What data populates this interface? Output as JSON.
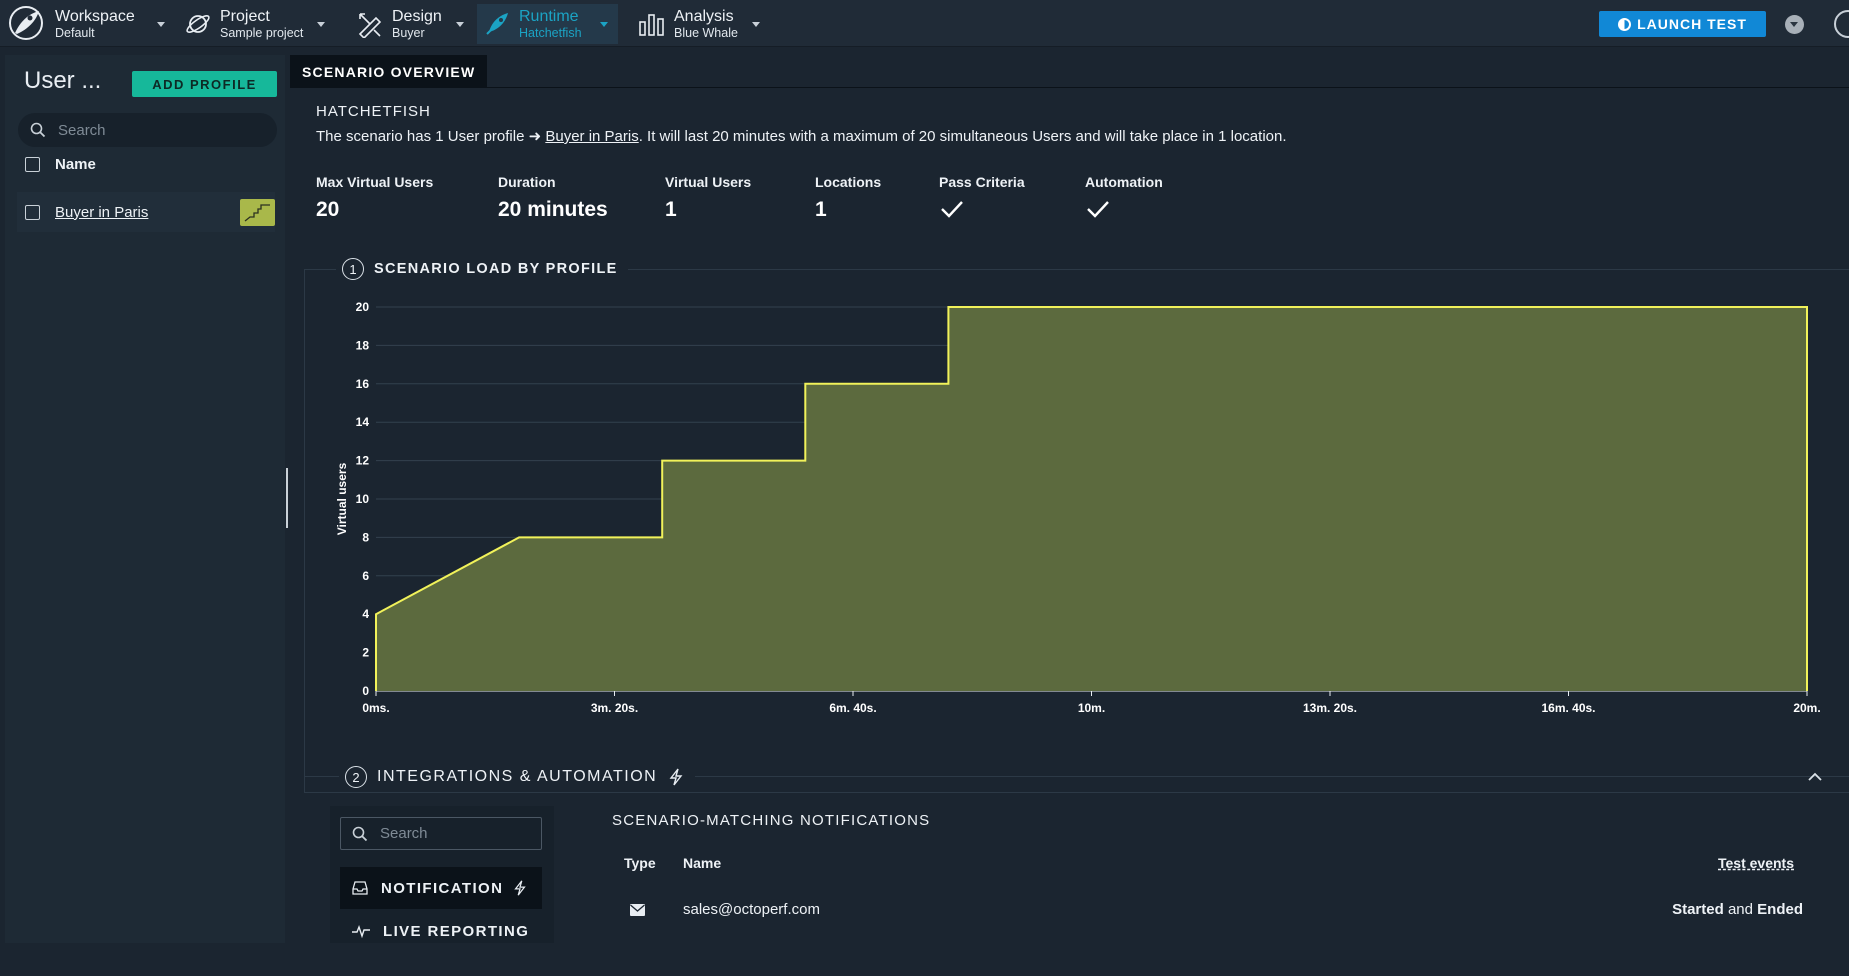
{
  "nav": {
    "items": [
      {
        "label": "Workspace",
        "sub": "Default",
        "icon": "planet-icon"
      },
      {
        "label": "Project",
        "sub": "Sample project",
        "icon": "planet-ring-icon"
      },
      {
        "label": "Design",
        "sub": "Buyer",
        "icon": "design-tools-icon"
      },
      {
        "label": "Runtime",
        "sub": "Hatchetfish",
        "icon": "rocket-icon"
      },
      {
        "label": "Analysis",
        "sub": "Blue Whale",
        "icon": "bar-chart-icon"
      }
    ],
    "launch_label": "LAUNCH TEST",
    "accent": "#1ba3c4",
    "launch_color": "#1188d6"
  },
  "sidebar": {
    "title": "User ...",
    "add_profile_label": "ADD PROFILE",
    "search_placeholder": "Search",
    "column_name": "Name",
    "profiles": [
      {
        "name": "Buyer in Paris",
        "color": "#a9b84a"
      }
    ],
    "add_color": "#16b89a"
  },
  "tab": {
    "label": "SCENARIO OVERVIEW"
  },
  "scenario": {
    "name": "HATCHETFISH",
    "desc_prefix": "The scenario has 1 User profile ➜ ",
    "desc_link": "Buyer in Paris",
    "desc_suffix": ". It will last 20 minutes with a maximum of 20 simultaneous Users and will take place in 1 location."
  },
  "stats": {
    "max_vu_label": "Max Virtual Users",
    "max_vu_value": "20",
    "duration_label": "Duration",
    "duration_value": "20 minutes",
    "vu_label": "Virtual Users",
    "vu_value": "1",
    "locations_label": "Locations",
    "locations_value": "1",
    "pass_label": "Pass Criteria",
    "automation_label": "Automation"
  },
  "load_section": {
    "number": "1",
    "title": "SCENARIO LOAD BY PROFILE"
  },
  "chart_data": {
    "type": "area",
    "title": "",
    "xlabel": "",
    "ylabel": "Virtual users",
    "x_unit": "seconds",
    "xlim": [
      0,
      1200
    ],
    "ylim": [
      0,
      20
    ],
    "x_ticks": [
      {
        "v": 0,
        "label": "0ms."
      },
      {
        "v": 200,
        "label": "3m. 20s."
      },
      {
        "v": 400,
        "label": "6m. 40s."
      },
      {
        "v": 600,
        "label": "10m."
      },
      {
        "v": 800,
        "label": "13m. 20s."
      },
      {
        "v": 1000,
        "label": "16m. 40s."
      },
      {
        "v": 1200,
        "label": "20m."
      }
    ],
    "y_ticks": [
      0,
      2,
      4,
      6,
      8,
      10,
      12,
      14,
      16,
      18,
      20
    ],
    "series": [
      {
        "name": "Buyer in Paris",
        "color": "#f1f25a",
        "fill": "#5c6a3e",
        "x": [
          0,
          0,
          120,
          240,
          240,
          360,
          360,
          480,
          480,
          1200,
          1200
        ],
        "y": [
          0,
          4,
          8,
          8,
          12,
          12,
          16,
          16,
          20,
          20,
          0
        ]
      }
    ],
    "grid": true
  },
  "integrations": {
    "number": "2",
    "title": "INTEGRATIONS & AUTOMATION",
    "search_placeholder": "Search",
    "items": [
      {
        "label": "NOTIFICATION",
        "icon": "inbox-icon"
      },
      {
        "label": "LIVE REPORTING",
        "icon": "pulse-icon"
      }
    ],
    "notifications_title": "SCENARIO-MATCHING NOTIFICATIONS",
    "columns": {
      "type": "Type",
      "name": "Name",
      "events": "Test events"
    },
    "rows": [
      {
        "type_icon": "mail-icon",
        "name": "sales@octoperf.com",
        "ev1": "Started",
        "and": "and",
        "ev2": "Ended"
      }
    ]
  }
}
